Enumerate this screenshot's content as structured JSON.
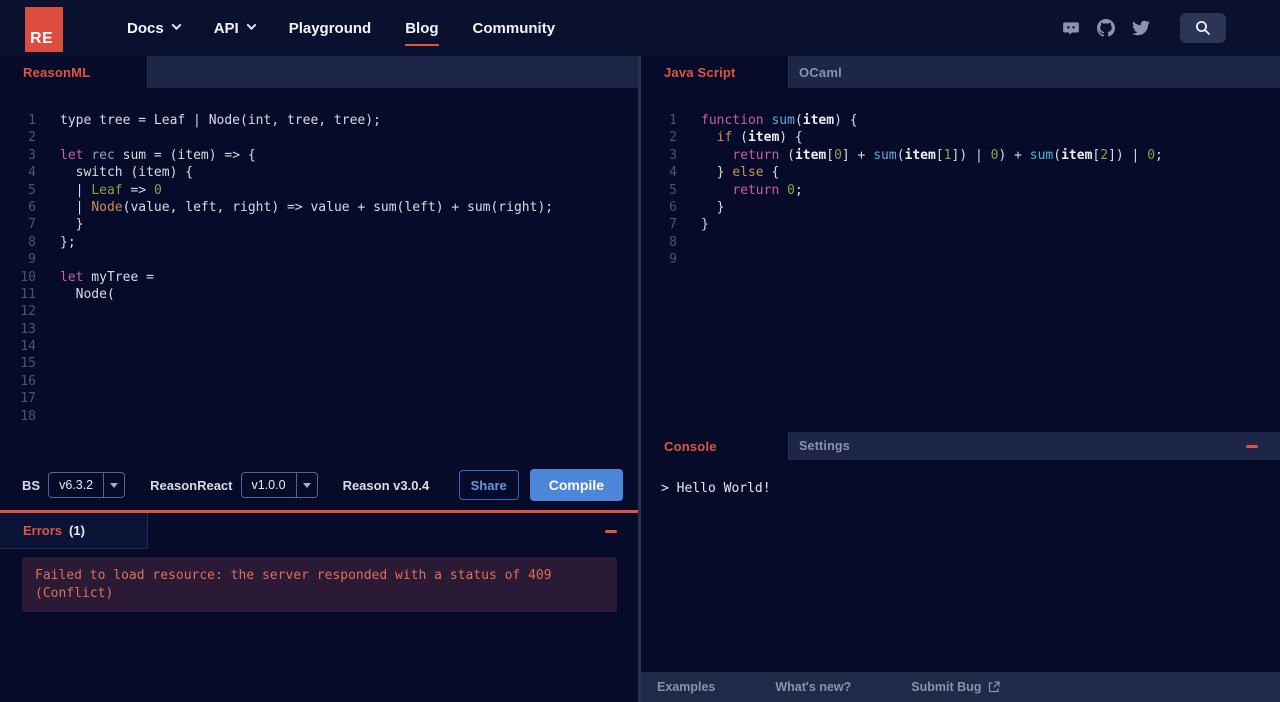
{
  "colors": {
    "accent_red": "#e0543f",
    "logo_bg": "#dc4c3f",
    "compile_blue": "#4c86d8",
    "share_blue": "#5f9ae8",
    "error_text": "#dd6f5a",
    "error_bg": "#2a1a35"
  },
  "navbar": {
    "logo_text": "RE",
    "items": [
      {
        "label": "Docs",
        "has_caret": true,
        "active": false
      },
      {
        "label": "API",
        "has_caret": true,
        "active": false
      },
      {
        "label": "Playground",
        "has_caret": false,
        "active": false
      },
      {
        "label": "Blog",
        "has_caret": false,
        "active": true
      },
      {
        "label": "Community",
        "has_caret": false,
        "active": false
      }
    ],
    "icons": [
      "discord-icon",
      "github-icon",
      "twitter-icon",
      "search-icon"
    ]
  },
  "left_pane": {
    "tab": "ReasonML",
    "editor": {
      "total_lines": 18,
      "lines": {
        "1": [
          [
            "w",
            "type tree = Leaf | Node(int, tree, tree);"
          ]
        ],
        "3": [
          [
            "pk",
            "let"
          ],
          [
            "w",
            " "
          ],
          [
            "rc",
            "rec"
          ],
          [
            "w",
            " sum = (item) => {"
          ]
        ],
        "4": [
          [
            "w",
            "  switch (item) {"
          ]
        ],
        "5": [
          [
            "w",
            "  | "
          ],
          [
            "gr",
            "Leaf"
          ],
          [
            "w",
            " => "
          ],
          [
            "gr",
            "0"
          ]
        ],
        "6": [
          [
            "w",
            "  | "
          ],
          [
            "or",
            "Node"
          ],
          [
            "w",
            "(value, left, right) => value + sum(left) + sum(right);"
          ]
        ],
        "7": [
          [
            "w",
            "  }"
          ]
        ],
        "8": [
          [
            "w",
            "};"
          ]
        ],
        "10": [
          [
            "pk",
            "let"
          ],
          [
            "w",
            " myTree ="
          ]
        ],
        "11": [
          [
            "w",
            "  Node("
          ]
        ]
      }
    },
    "toolbar": {
      "bs_label": "BS",
      "bs_version": "v6.3.2",
      "reasonreact_label": "ReasonReact",
      "reasonreact_version": "v1.0.0",
      "reason_version": "Reason v3.0.4",
      "share_label": "Share",
      "compile_label": "Compile"
    },
    "errors": {
      "title": "Errors",
      "count": "(1)",
      "message_line1": "Failed to load resource: the server responded with a status of 409",
      "message_line2": "(Conflict)"
    }
  },
  "right_pane": {
    "tabs": {
      "active": "Java Script",
      "inactive": "OCaml"
    },
    "editor": {
      "total_lines": 9,
      "lines": {
        "1": [
          [
            "pk",
            "function"
          ],
          [
            "w",
            " "
          ],
          [
            "bl",
            "sum"
          ],
          [
            "w",
            "("
          ],
          [
            "bw",
            "item"
          ],
          [
            "w",
            ") {"
          ]
        ],
        "2": [
          [
            "w",
            "  "
          ],
          [
            "or",
            "if"
          ],
          [
            "w",
            " ("
          ],
          [
            "bw",
            "item"
          ],
          [
            "w",
            ") {"
          ]
        ],
        "3": [
          [
            "w",
            "    "
          ],
          [
            "pk",
            "return"
          ],
          [
            "w",
            " ("
          ],
          [
            "bw",
            "item"
          ],
          [
            "w",
            "["
          ],
          [
            "gr",
            "0"
          ],
          [
            "w",
            "] + "
          ],
          [
            "bl",
            "sum"
          ],
          [
            "w",
            "("
          ],
          [
            "bw",
            "item"
          ],
          [
            "w",
            "["
          ],
          [
            "gr",
            "1"
          ],
          [
            "w",
            "]) | "
          ],
          [
            "gr",
            "0"
          ],
          [
            "w",
            ") + "
          ],
          [
            "bl",
            "sum"
          ],
          [
            "w",
            "("
          ],
          [
            "bw",
            "item"
          ],
          [
            "w",
            "["
          ],
          [
            "gr",
            "2"
          ],
          [
            "w",
            "]) | "
          ],
          [
            "gr",
            "0"
          ],
          [
            "w",
            ";"
          ]
        ],
        "4": [
          [
            "w",
            "  } "
          ],
          [
            "or",
            "else"
          ],
          [
            "w",
            " {"
          ]
        ],
        "5": [
          [
            "w",
            "    "
          ],
          [
            "pk",
            "return"
          ],
          [
            "w",
            " "
          ],
          [
            "gr",
            "0"
          ],
          [
            "w",
            ";"
          ]
        ],
        "6": [
          [
            "w",
            "  }"
          ]
        ],
        "7": [
          [
            "w",
            "}"
          ]
        ]
      }
    },
    "console": {
      "tab": "Console",
      "settings_tab": "Settings",
      "output": "> Hello World!"
    },
    "footer": {
      "links": [
        "Examples",
        "What's new?",
        "Submit Bug"
      ]
    }
  }
}
